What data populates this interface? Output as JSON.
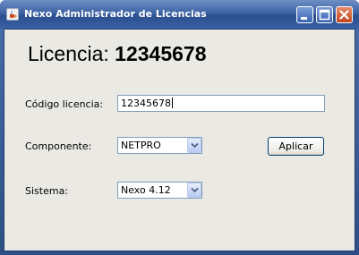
{
  "window": {
    "title": "Nexo Administrador de Licencias",
    "controls": [
      "minimize-icon",
      "maximize-icon",
      "close-icon"
    ]
  },
  "header": {
    "prefix": "Licencia:",
    "number": "12345678"
  },
  "form": {
    "license_code": {
      "label": "Código licencia:",
      "value": "12345678"
    },
    "component": {
      "label": "Componente:",
      "selected": "NETPRO"
    },
    "system": {
      "label": "Sistema:",
      "selected": "Nexo 4.12"
    },
    "apply_label": "Aplicar"
  },
  "colors": {
    "titlebar": "#3d63a3",
    "client_bg": "#ebe9e3",
    "field_border": "#7f9db9",
    "close_button": "#c0431c"
  }
}
